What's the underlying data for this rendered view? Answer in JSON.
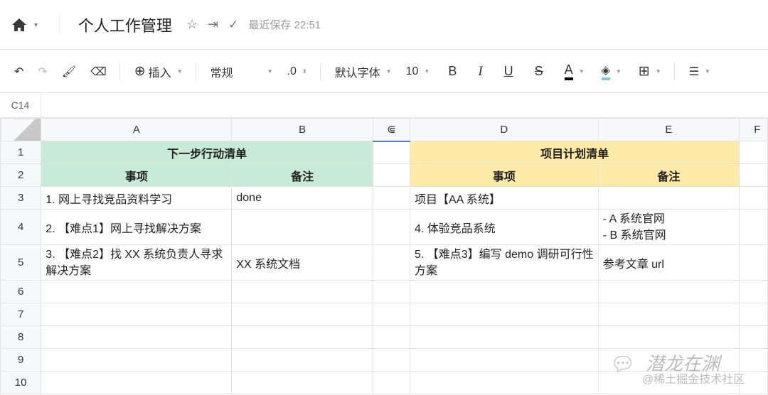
{
  "header": {
    "title": "个人工作管理",
    "saved": "最近保存 22:51"
  },
  "toolbar": {
    "insert": "插入",
    "format": "常规",
    "decimal": ".0",
    "font": "默认字体",
    "size": "10",
    "bold": "B",
    "italic": "I",
    "underline": "U",
    "strike": "S",
    "color": "A"
  },
  "cell_ref": "C14",
  "columns": [
    "A",
    "B",
    "",
    "D",
    "E",
    "F"
  ],
  "rows": [
    "1",
    "2",
    "3",
    "4",
    "5",
    "6",
    "7",
    "8",
    "9",
    "10"
  ],
  "left": {
    "title": "下一步行动清单",
    "h1": "事项",
    "h2": "备注",
    "r3": [
      "1. 网上寻找竞品资料学习",
      "done"
    ],
    "r4": [
      "2. 【难点1】网上寻找解决方案",
      ""
    ],
    "r5": [
      "3. 【难点2】找 XX 系统负责人寻求解决方案",
      "XX 系统文档"
    ]
  },
  "right": {
    "title": "项目计划清单",
    "h1": "事项",
    "h2": "备注",
    "r3": [
      "项目【AA 系统】",
      ""
    ],
    "r4": [
      "4. 体验竞品系统",
      "- A 系统官网\n- B 系统官网"
    ],
    "r5": [
      "5. 【难点3】编写 demo 调研可行性方案",
      "参考文章 url"
    ]
  },
  "watermark": {
    "line1": "潜龙在渊",
    "line2": "@稀土掘金技术社区"
  }
}
